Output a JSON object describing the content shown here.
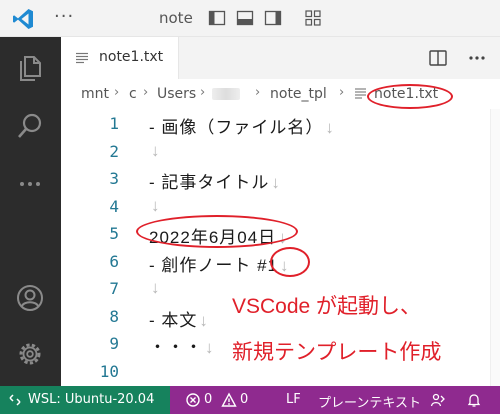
{
  "titlebar": {
    "menu_dots": "···",
    "title": "note"
  },
  "tab": {
    "label": "note1.txt"
  },
  "breadcrumb": {
    "items": [
      "mnt",
      "c",
      "Users",
      "note_tpl",
      "note1.txt"
    ],
    "separator": "›"
  },
  "editor": {
    "line_numbers": [
      "1",
      "2",
      "3",
      "4",
      "5",
      "6",
      "7",
      "8",
      "9",
      "10"
    ],
    "lines": [
      "- 画像（ファイル名）",
      "",
      "- 記事タイトル",
      "",
      "2022年6月04日",
      "- 創作ノート #1",
      "",
      "- 本文",
      "・・・",
      ""
    ],
    "eol_marker": "↓"
  },
  "annotation": {
    "caption_line1": "VSCode が起動し、",
    "caption_line2": "新規テンプレート作成",
    "color": "#e0202a"
  },
  "statusbar": {
    "remote_label": "WSL: Ubuntu-20.04",
    "errors": "0",
    "warnings": "0",
    "eol": "LF",
    "language": "プレーンテキスト",
    "remote_color": "#16825d",
    "bar_color": "#8f2a8f"
  },
  "icons": {
    "activity": [
      "files-icon",
      "search-icon",
      "more-icon",
      "account-icon",
      "settings-gear-icon"
    ],
    "title_controls": [
      "layout-sidebar-icon",
      "layout-panel-icon",
      "layout-sidebar-right-icon",
      "customize-layout-icon"
    ]
  }
}
